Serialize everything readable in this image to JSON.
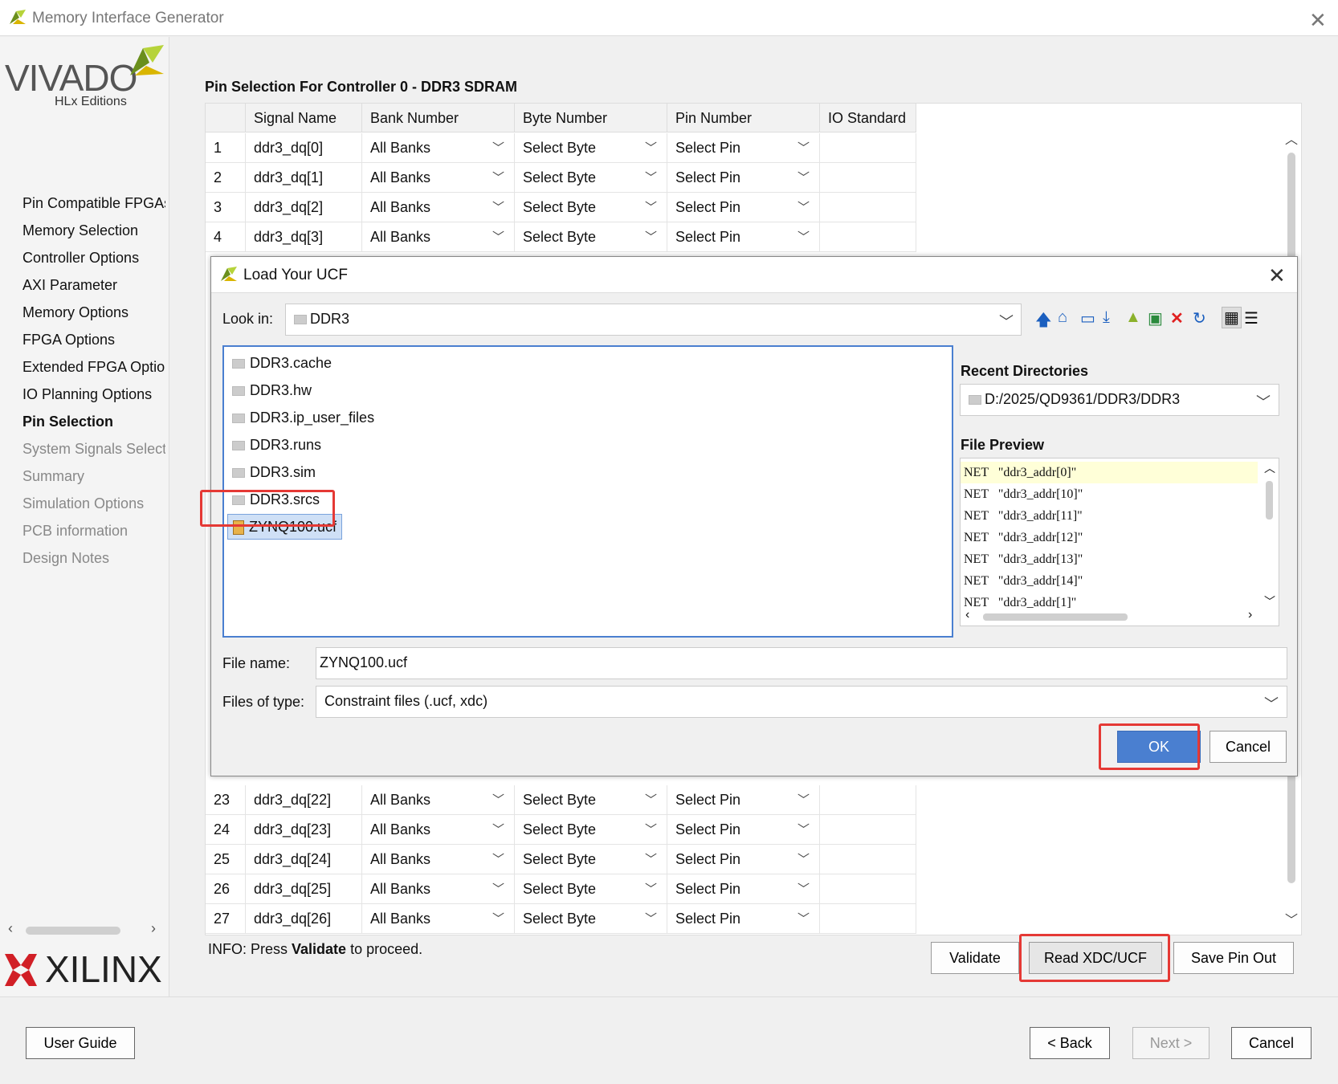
{
  "window": {
    "title": "Memory Interface Generator"
  },
  "branding": {
    "product": "VIVADO",
    "edition": "HLx Editions",
    "vendor": "XILINX"
  },
  "sidebar": {
    "items": [
      {
        "label": "Pin Compatible FPGAs",
        "state": "done"
      },
      {
        "label": "Memory Selection",
        "state": "done"
      },
      {
        "label": "Controller Options",
        "state": "done"
      },
      {
        "label": "AXI Parameter",
        "state": "done"
      },
      {
        "label": "Memory Options",
        "state": "done"
      },
      {
        "label": "FPGA Options",
        "state": "done"
      },
      {
        "label": "Extended FPGA Options",
        "state": "done"
      },
      {
        "label": "IO Planning Options",
        "state": "done"
      },
      {
        "label": "Pin Selection",
        "state": "current"
      },
      {
        "label": "System Signals Selection",
        "state": "todo"
      },
      {
        "label": "Summary",
        "state": "todo"
      },
      {
        "label": "Simulation Options",
        "state": "todo"
      },
      {
        "label": "PCB information",
        "state": "todo"
      },
      {
        "label": "Design Notes",
        "state": "todo"
      }
    ]
  },
  "main": {
    "title": "Pin Selection For Controller 0 - DDR3 SDRAM",
    "columns": [
      "",
      "Signal Name",
      "Bank Number",
      "Byte Number",
      "Pin Number",
      "IO Standard"
    ],
    "rows_top": [
      [
        "1",
        "ddr3_dq[0]",
        "All Banks",
        "Select Byte",
        "Select Pin",
        ""
      ],
      [
        "2",
        "ddr3_dq[1]",
        "All Banks",
        "Select Byte",
        "Select Pin",
        ""
      ],
      [
        "3",
        "ddr3_dq[2]",
        "All Banks",
        "Select Byte",
        "Select Pin",
        ""
      ],
      [
        "4",
        "ddr3_dq[3]",
        "All Banks",
        "Select Byte",
        "Select Pin",
        ""
      ]
    ],
    "rows_bottom": [
      [
        "23",
        "ddr3_dq[22]",
        "All Banks",
        "Select Byte",
        "Select Pin",
        ""
      ],
      [
        "24",
        "ddr3_dq[23]",
        "All Banks",
        "Select Byte",
        "Select Pin",
        ""
      ],
      [
        "25",
        "ddr3_dq[24]",
        "All Banks",
        "Select Byte",
        "Select Pin",
        ""
      ],
      [
        "26",
        "ddr3_dq[25]",
        "All Banks",
        "Select Byte",
        "Select Pin",
        ""
      ],
      [
        "27",
        "ddr3_dq[26]",
        "All Banks",
        "Select Byte",
        "Select Pin",
        ""
      ]
    ],
    "info_prefix": "INFO: Press ",
    "info_bold": "Validate",
    "info_suffix": " to proceed.",
    "validate_label": "Validate",
    "read_label": "Read XDC/UCF",
    "save_label": "Save Pin Out"
  },
  "footer": {
    "user_guide": "User Guide",
    "back": "< Back",
    "next": "Next >",
    "cancel": "Cancel"
  },
  "dialog": {
    "title": "Load Your UCF",
    "look_in_label": "Look in:",
    "look_in_value": "DDR3",
    "files": [
      {
        "name": "DDR3.cache",
        "kind": "folder"
      },
      {
        "name": "DDR3.hw",
        "kind": "folder"
      },
      {
        "name": "DDR3.ip_user_files",
        "kind": "folder"
      },
      {
        "name": "DDR3.runs",
        "kind": "folder"
      },
      {
        "name": "DDR3.sim",
        "kind": "folder"
      },
      {
        "name": "DDR3.srcs",
        "kind": "folder"
      },
      {
        "name": "ZYNQ100.ucf",
        "kind": "file",
        "selected": true
      }
    ],
    "recent_label": "Recent Directories",
    "recent_value": "D:/2025/QD9361/DDR3/DDR3",
    "preview_label": "File Preview",
    "preview_lines": [
      "NET   \"ddr3_addr[0]\"",
      "NET   \"ddr3_addr[10]\"",
      "NET   \"ddr3_addr[11]\"",
      "NET   \"ddr3_addr[12]\"",
      "NET   \"ddr3_addr[13]\"",
      "NET   \"ddr3_addr[14]\"",
      "NET   \"ddr3_addr[1]\""
    ],
    "file_name_label": "File name:",
    "file_name_value": "ZYNQ100.ucf",
    "file_type_label": "Files of type:",
    "file_type_value": "Constraint files (.ucf, xdc)",
    "ok_label": "OK",
    "cancel_label": "Cancel"
  },
  "colors": {
    "accent": "#4a7fd0",
    "highlight": "#e53935",
    "ok_button": "#4a7fd0"
  }
}
